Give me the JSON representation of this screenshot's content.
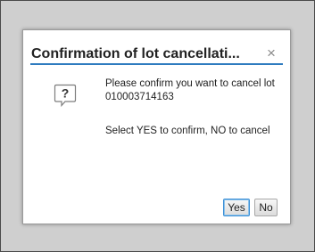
{
  "dialog": {
    "title": "Confirmation of lot cancellati...",
    "close_symbol": "×",
    "icon": "question-icon",
    "icon_glyph": "?",
    "message_line1": "Please confirm you want to cancel lot 010003714163",
    "message_line2": "Select YES to confirm, NO to cancel",
    "yes_label": "Yes",
    "no_label": "No",
    "accent_color": "#2e7bbf"
  }
}
